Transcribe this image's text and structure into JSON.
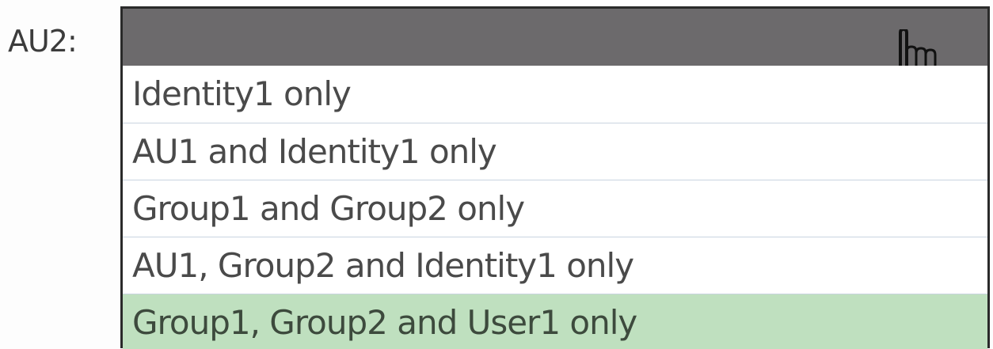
{
  "field": {
    "label": "AU2:"
  },
  "dropdown": {
    "header_color": "#6c6a6c",
    "selected_color": "#bfe0bf",
    "options": [
      {
        "label": "Identity1 only",
        "selected": false
      },
      {
        "label": "AU1 and Identity1 only",
        "selected": false
      },
      {
        "label": "Group1 and Group2 only",
        "selected": false
      },
      {
        "label": "AU1, Group2 and Identity1 only",
        "selected": false
      },
      {
        "label": "Group1, Group2 and User1 only",
        "selected": true
      }
    ],
    "icons": {
      "cursor": "hand-pointer-icon"
    }
  }
}
